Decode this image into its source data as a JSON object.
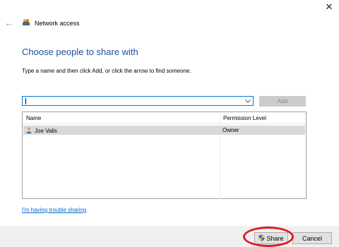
{
  "window": {
    "title": "Network access",
    "close_glyph": "✕",
    "back_glyph": "←"
  },
  "main": {
    "heading": "Choose people to share with",
    "instruction": "Type a name and then click Add, or click the arrow to find someone.",
    "combo_value": "",
    "add_label": "Add"
  },
  "list": {
    "columns": [
      "Name",
      "Permission Level"
    ],
    "rows": [
      {
        "name": "Joe Valis",
        "permission": "Owner",
        "selected": true
      }
    ]
  },
  "links": {
    "trouble": "I'm having trouble sharing"
  },
  "footer": {
    "share_label": "Share",
    "cancel_label": "Cancel"
  },
  "colors": {
    "heading": "#1f4e99",
    "link": "#0066cc",
    "highlight": "#d9202a",
    "selected_row": "#d9d9d9"
  }
}
